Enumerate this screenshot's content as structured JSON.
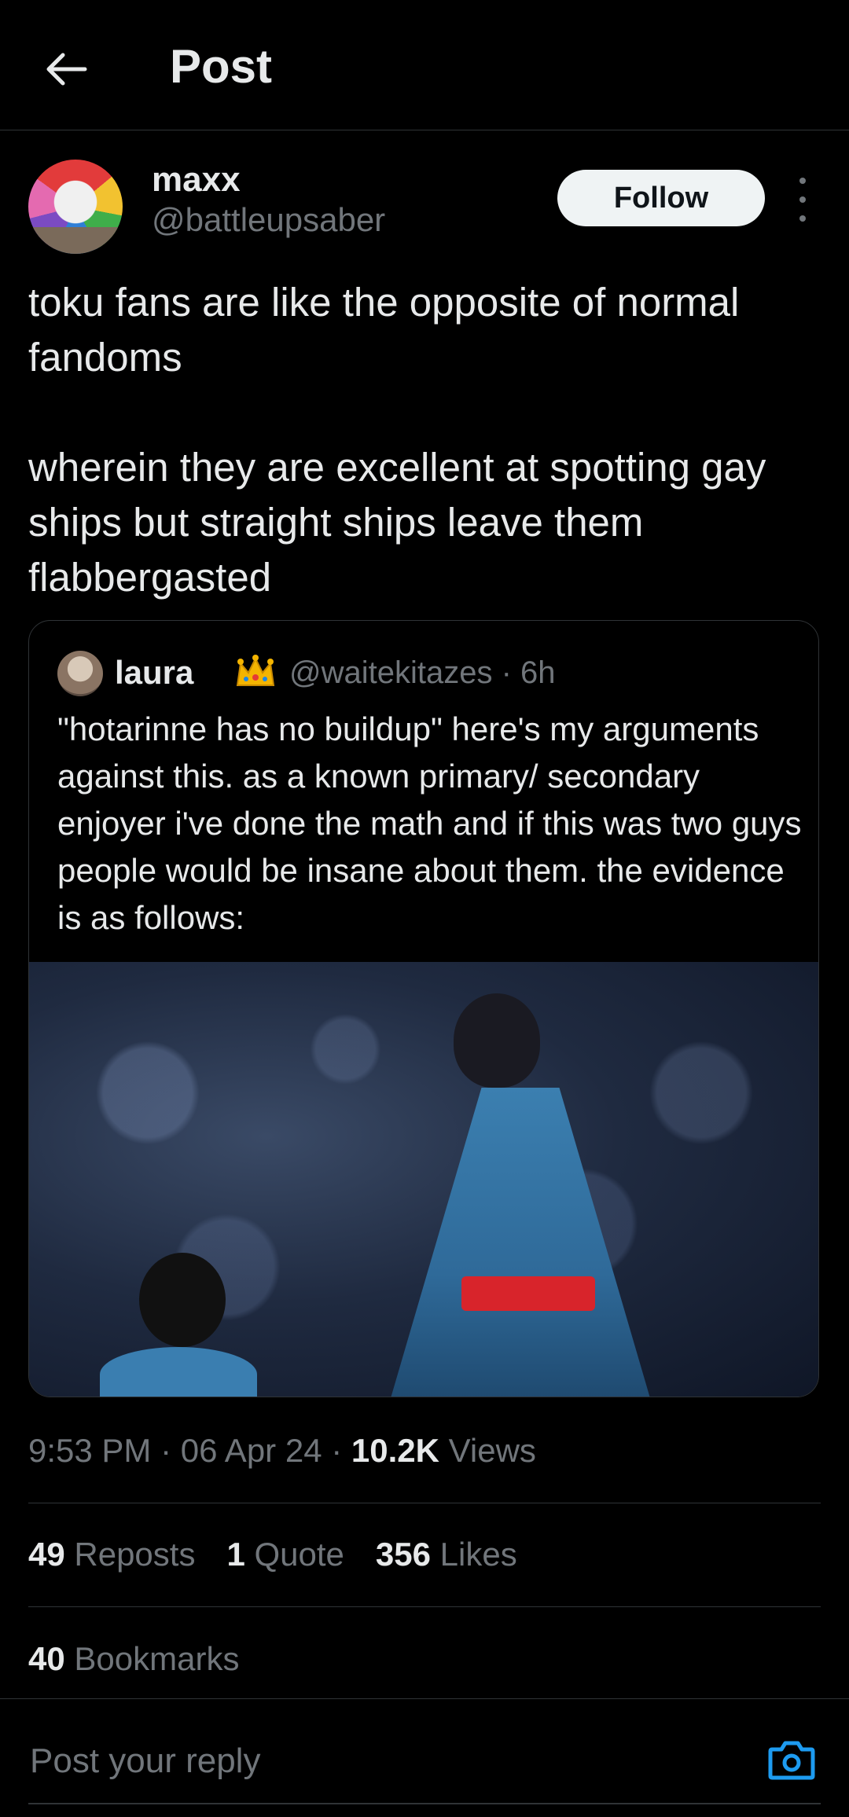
{
  "header": {
    "title": "Post"
  },
  "author": {
    "name": "maxx",
    "handle": "@battleupsaber",
    "follow_label": "Follow"
  },
  "post": {
    "text": "toku fans are like the opposite of normal fandoms\n\nwherein they are excellent at spotting gay ships but straight ships leave them flabbergasted"
  },
  "quote": {
    "name": "laura",
    "handle_time": "@waitekitazes · 6h",
    "text": "\"hotarinne has no buildup\" here's my arguments against this. as a known primary/ secondary enjoyer i've done the math and if this was two guys people would be insane about them. the evidence is as follows:"
  },
  "meta": {
    "time": "9:53 PM · 06 Apr 24 · ",
    "views_count": "10.2K",
    "views_label": " Views"
  },
  "stats": {
    "reposts_count": "49",
    "reposts_label": " Reposts",
    "quote_count": "1",
    "quote_label": " Quote",
    "likes_count": "356",
    "likes_label": " Likes",
    "bookmarks_count": "40",
    "bookmarks_label": " Bookmarks"
  },
  "reply": {
    "placeholder": "Post your reply"
  },
  "colors": {
    "background": "#000000",
    "text": "#e7e9ea",
    "secondary": "#71767b",
    "border": "#2f3336",
    "accent": "#1d9bf0"
  },
  "icons": {
    "back": "arrow-left-icon",
    "more": "more-vertical-icon",
    "crown": "crown-icon",
    "camera": "camera-icon"
  }
}
